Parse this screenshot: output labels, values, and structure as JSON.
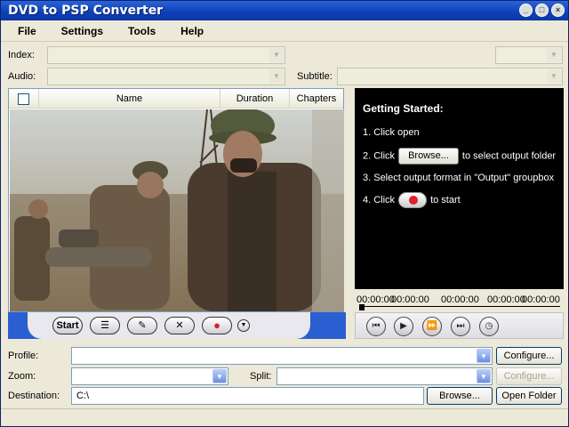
{
  "window": {
    "title": "DVD to PSP Converter"
  },
  "menu": [
    "File",
    "Settings",
    "Tools",
    "Help"
  ],
  "source": {
    "index_label": "Index:",
    "audio_label": "Audio:",
    "subtitle_label": "Subtitle:"
  },
  "list": {
    "columns": {
      "name": "Name",
      "duration": "Duration",
      "chapters": "Chapters"
    }
  },
  "list_toolbar": {
    "start": "Start"
  },
  "getting_started": {
    "title": "Getting Started:",
    "step1": "1. Click open",
    "step2_pre": "2. Click",
    "step2_button": "Browse...",
    "step2_post": "to select output folder",
    "step3": "3. Select output format in \"Output\" groupbox",
    "step4_pre": "4. Click",
    "step4_post": "to start"
  },
  "times": {
    "t1": "00:00:00",
    "t2": "00:00:00",
    "t3": "00:00:00",
    "t4": "00:00:00",
    "t5": "00:00:00"
  },
  "output": {
    "profile_label": "Profile:",
    "zoom_label": "Zoom:",
    "split_label": "Split:",
    "destination_label": "Destination:",
    "destination_value": "C:\\",
    "configure1": "Configure...",
    "configure2": "Configure...",
    "browse": "Browse...",
    "open_folder": "Open Folder"
  },
  "colors": {
    "title_bar": "#0d3fb5",
    "toolbar_blue": "#2b5ed1",
    "record": "#e0202c"
  }
}
